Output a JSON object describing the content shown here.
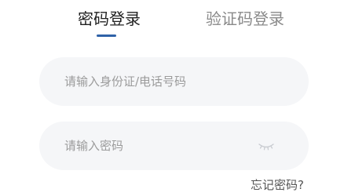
{
  "tabs": {
    "password_login": "密码登录",
    "code_login": "验证码登录",
    "active": "password_login"
  },
  "account_field": {
    "placeholder": "请输入身份证/电话号码",
    "value": ""
  },
  "password_field": {
    "placeholder": "请输入密码",
    "value": "",
    "toggle_icon": "eye-closed-icon"
  },
  "forgot_password": "忘记密码?",
  "colors": {
    "accent": "#2f62a8",
    "field_bg": "#f5f6f8",
    "placeholder": "#9b9b9b",
    "tab_inactive": "#8a8a8a"
  }
}
